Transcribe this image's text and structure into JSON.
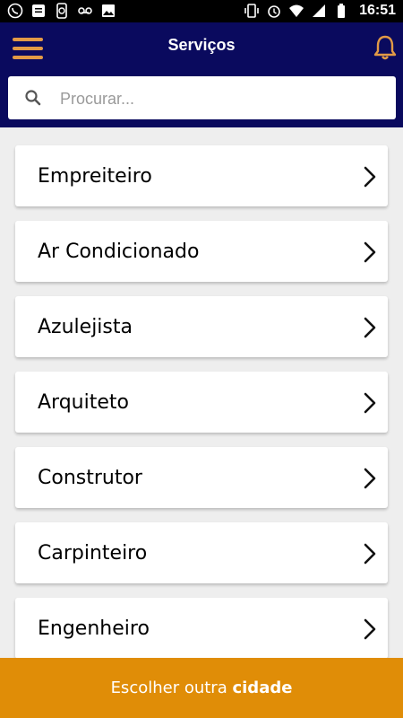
{
  "status_bar": {
    "time": "16:51",
    "icons_left": [
      "whatsapp-icon",
      "message-icon",
      "phone-sync-icon",
      "voicemail-icon",
      "image-icon"
    ],
    "icons_right": [
      "vibrate-icon",
      "alarm-icon",
      "wifi-icon",
      "signal-icon",
      "battery-icon"
    ]
  },
  "header": {
    "title": "Serviços",
    "menu_icon": "hamburger-menu-icon",
    "notification_icon": "bell-icon",
    "accent_color": "#e29a46",
    "background_color": "#0a0a5e"
  },
  "search": {
    "placeholder": "Procurar...",
    "value": ""
  },
  "services": [
    {
      "label": "Empreiteiro"
    },
    {
      "label": "Ar Condicionado"
    },
    {
      "label": "Azulejista"
    },
    {
      "label": "Arquiteto"
    },
    {
      "label": "Construtor"
    },
    {
      "label": "Carpinteiro"
    },
    {
      "label": "Engenheiro"
    }
  ],
  "footer": {
    "prefix": "Escolher outra ",
    "emphasis": "cidade",
    "background_color": "#e08d07"
  }
}
